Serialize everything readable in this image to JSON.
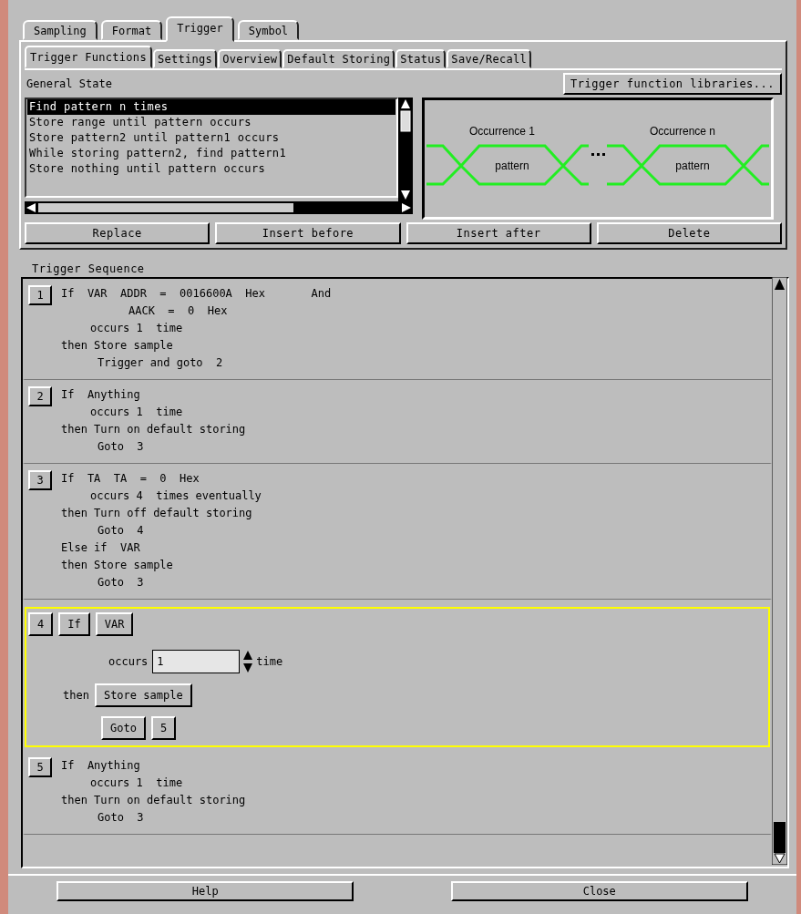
{
  "tabs": [
    {
      "label": "Sampling",
      "selected": false
    },
    {
      "label": "Format",
      "selected": false
    },
    {
      "label": "Trigger",
      "selected": true
    },
    {
      "label": "Symbol",
      "selected": false
    }
  ],
  "subtabs": [
    {
      "label": "Trigger Functions",
      "selected": true
    },
    {
      "label": "Settings",
      "selected": false
    },
    {
      "label": "Overview",
      "selected": false
    },
    {
      "label": "Default Storing",
      "selected": false
    },
    {
      "label": "Status",
      "selected": false
    },
    {
      "label": "Save/Recall",
      "selected": false
    }
  ],
  "general_state": {
    "label": "General State",
    "libraries_button": "Trigger function libraries...",
    "functions": [
      {
        "label": "Find pattern n times",
        "selected": true
      },
      {
        "label": "Store range until pattern occurs",
        "selected": false
      },
      {
        "label": "Store pattern2 until pattern1 occurs",
        "selected": false
      },
      {
        "label": "While storing pattern2, find pattern1",
        "selected": false
      },
      {
        "label": "Store nothing until pattern occurs",
        "selected": false
      }
    ],
    "diagram": {
      "occurrences": [
        {
          "label": "Occurrence 1",
          "pattern": "pattern"
        },
        {
          "label": "Occurrence n",
          "pattern": "pattern"
        }
      ]
    },
    "buttons": [
      "Replace",
      "Insert before",
      "Insert after",
      "Delete"
    ]
  },
  "trigger_sequence": {
    "label": "Trigger Sequence",
    "steps": [
      {
        "kind": "summary",
        "number": "1",
        "selected": false,
        "lines": [
          {
            "kind": "if",
            "text": "If  VAR  ADDR  =  0016600A  Hex       And"
          },
          {
            "kind": "cond",
            "text": "AACK  =  0  Hex"
          },
          {
            "kind": "occurs",
            "text": "occurs 1  time"
          },
          {
            "kind": "then",
            "text": "then Store sample"
          },
          {
            "kind": "action",
            "text": "Trigger and goto  2"
          }
        ]
      },
      {
        "kind": "summary",
        "number": "2",
        "selected": false,
        "lines": [
          {
            "kind": "if",
            "text": "If  Anything"
          },
          {
            "kind": "occurs",
            "text": "occurs 1  time"
          },
          {
            "kind": "then",
            "text": "then Turn on default storing"
          },
          {
            "kind": "action",
            "text": "Goto  3"
          }
        ]
      },
      {
        "kind": "summary",
        "number": "3",
        "selected": false,
        "lines": [
          {
            "kind": "if",
            "text": "If  TA  TA  =  0  Hex"
          },
          {
            "kind": "occurs",
            "text": "occurs 4  times eventually"
          },
          {
            "kind": "then",
            "text": "then Turn off default storing"
          },
          {
            "kind": "action",
            "text": "Goto  4"
          },
          {
            "kind": "if",
            "text": "Else if  VAR"
          },
          {
            "kind": "then",
            "text": "then Store sample"
          },
          {
            "kind": "action",
            "text": "Goto  3"
          }
        ]
      },
      {
        "kind": "editor",
        "number": "4",
        "selected": true,
        "if_button": "If",
        "condition": "VAR",
        "occurs_label": "occurs",
        "count": "1",
        "time_label": "time",
        "then_label": "then",
        "action": "Store sample",
        "goto": "Goto",
        "target": "5"
      },
      {
        "kind": "summary",
        "number": "5",
        "selected": false,
        "lines": [
          {
            "kind": "if",
            "text": "If  Anything"
          },
          {
            "kind": "occurs",
            "text": "occurs 1  time"
          },
          {
            "kind": "then",
            "text": "then Turn on default storing"
          },
          {
            "kind": "action",
            "text": "Goto  3"
          }
        ]
      }
    ]
  },
  "footer_buttons": [
    "Help",
    "Close"
  ]
}
